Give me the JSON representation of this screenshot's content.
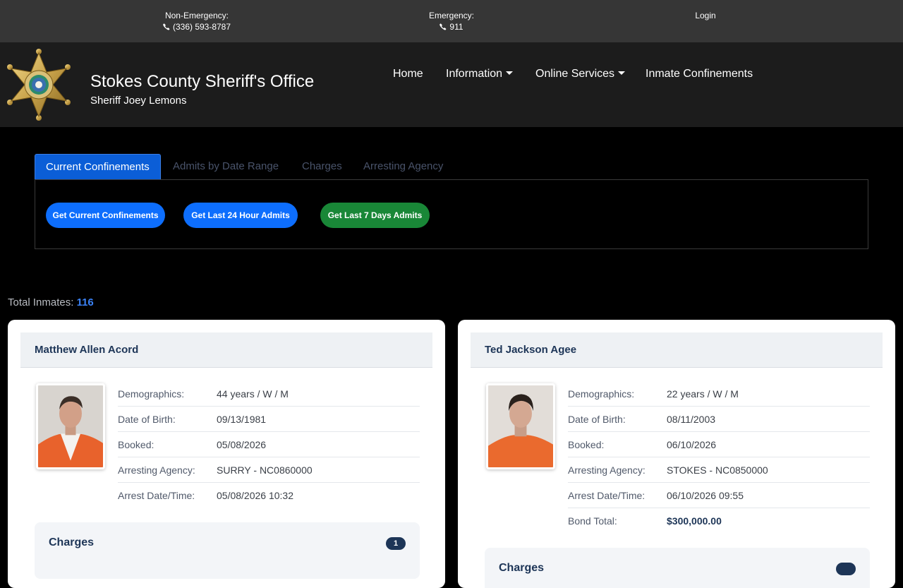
{
  "topbar": {
    "non_emergency_label": "Non-Emergency:",
    "non_emergency_phone": "(336) 593-8787",
    "emergency_label": "Emergency:",
    "emergency_phone": "911",
    "login": "Login"
  },
  "header": {
    "title": "Stokes County Sheriff's Office",
    "subtitle": "Sheriff Joey Lemons",
    "logo_icon": "sheriff-star-badge-icon",
    "nav": [
      {
        "label": "Home",
        "dropdown": false
      },
      {
        "label": "Information",
        "dropdown": true
      },
      {
        "label": "Online Services",
        "dropdown": true
      },
      {
        "label": "Inmate Confinements",
        "dropdown": false
      }
    ]
  },
  "tabs": [
    {
      "label": "Current Confinements",
      "active": true
    },
    {
      "label": "Admits by Date Range",
      "active": false
    },
    {
      "label": "Charges",
      "active": false
    },
    {
      "label": "Arresting Agency",
      "active": false
    }
  ],
  "buttons": {
    "current": "Get Current Confinements",
    "last24": "Get Last 24 Hour Admits",
    "last7": "Get Last 7 Days Admits"
  },
  "summary": {
    "total_label": "Total Inmates:",
    "total_count": "116"
  },
  "inmates": [
    {
      "name": "Matthew Allen Acord",
      "rows": [
        {
          "label": "Demographics:",
          "value": "44 years / W / M"
        },
        {
          "label": "Date of Birth:",
          "value": "09/13/1981"
        },
        {
          "label": "Booked:",
          "value": "05/08/2026"
        },
        {
          "label": "Arresting Agency:",
          "value": "SURRY - NC0860000"
        },
        {
          "label": "Arrest Date/Time:",
          "value": "05/08/2026 10:32"
        }
      ],
      "charges_label": "Charges",
      "charges_count": "1"
    },
    {
      "name": "Ted Jackson Agee",
      "rows": [
        {
          "label": "Demographics:",
          "value": "22 years / W / M"
        },
        {
          "label": "Date of Birth:",
          "value": "08/11/2003"
        },
        {
          "label": "Booked:",
          "value": "06/10/2026"
        },
        {
          "label": "Arresting Agency:",
          "value": "STOKES - NC0850000"
        },
        {
          "label": "Arrest Date/Time:",
          "value": "06/10/2026 09:55"
        },
        {
          "label": "Bond Total:",
          "value": "$300,000.00"
        }
      ],
      "charges_label": "Charges",
      "charges_count": ""
    }
  ],
  "colors": {
    "topbar": "#363636",
    "header": "#1c1c1c",
    "accent_blue": "#0d6efd",
    "accent_green": "#198737",
    "card_title": "#1d3557"
  }
}
